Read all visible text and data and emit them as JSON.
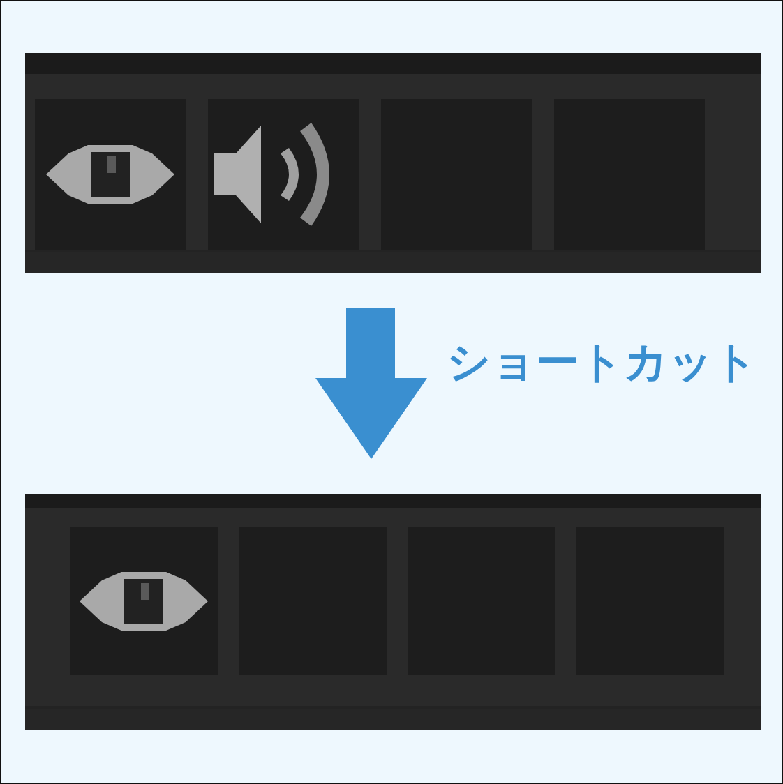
{
  "before": {
    "slots": [
      {
        "kind": "eye"
      },
      {
        "kind": "speaker"
      },
      {
        "kind": "empty"
      },
      {
        "kind": "empty"
      }
    ]
  },
  "arrow": {
    "label": "ショートカット"
  },
  "after": {
    "slots": [
      {
        "kind": "eye"
      },
      {
        "kind": "empty"
      },
      {
        "kind": "empty"
      },
      {
        "kind": "empty"
      }
    ]
  }
}
